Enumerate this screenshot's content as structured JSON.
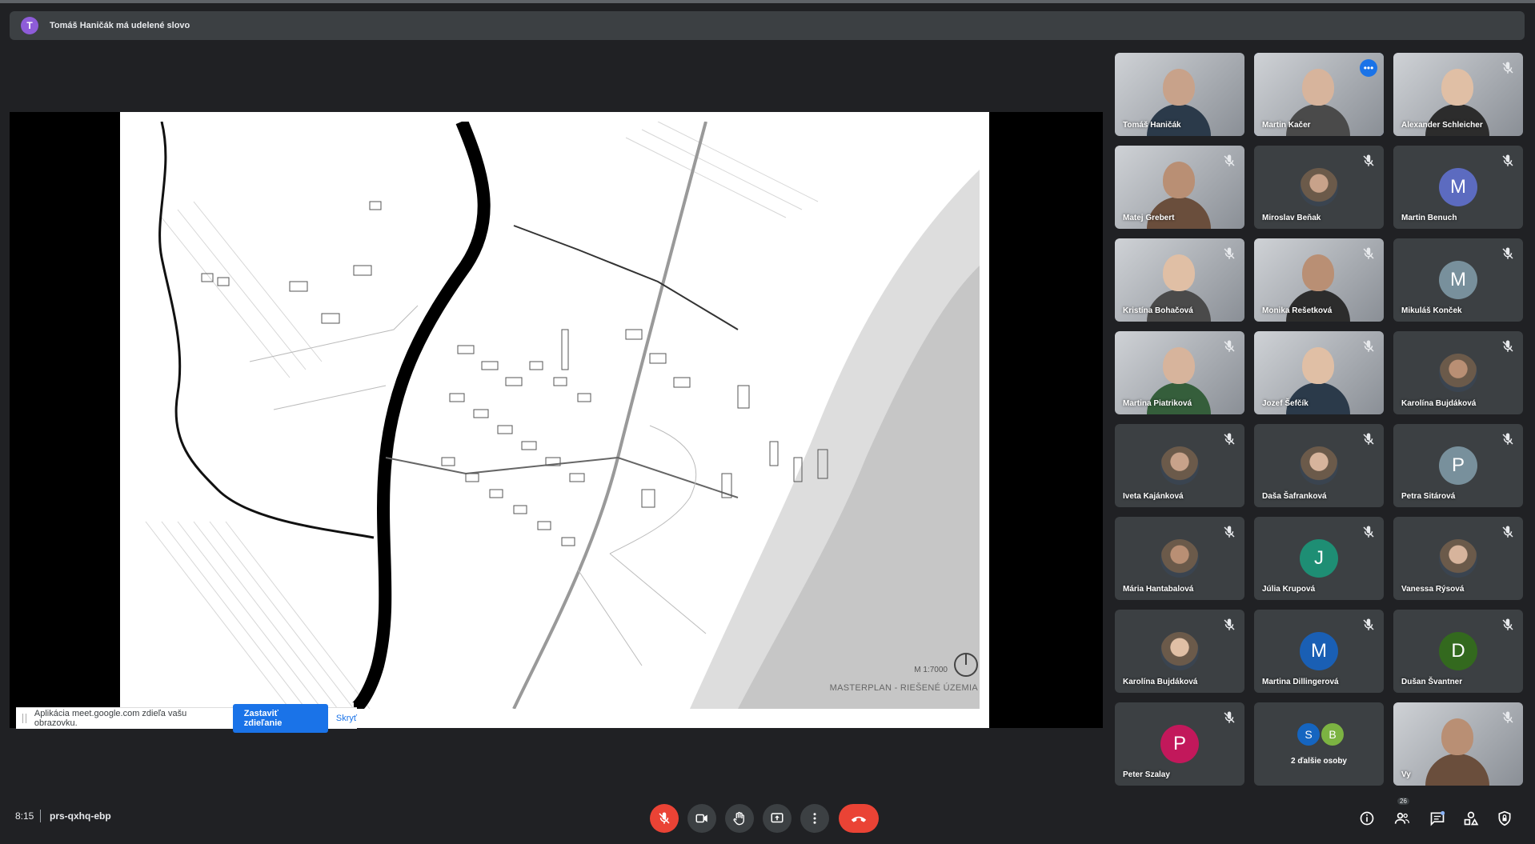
{
  "banner": {
    "avatar_letter": "T",
    "text": "Tomáš Haničák má udelené slovo"
  },
  "presentation": {
    "scale_text": "M 1:7000",
    "title_text": "MASTERPLAN - RIEŠENÉ ÚZEMIA"
  },
  "share_bar": {
    "message": "Aplikácia meet.google.com zdieľa vašu obrazovku.",
    "stop_label": "Zastaviť zdieľanie",
    "hide_label": "Skryť"
  },
  "participants": [
    {
      "name": "Tomáš Haničák",
      "kind": "video",
      "muted": false
    },
    {
      "name": "Martin Kačer",
      "kind": "video",
      "muted": false,
      "active": true
    },
    {
      "name": "Alexander Schleicher",
      "kind": "video",
      "muted": true
    },
    {
      "name": "Matej Grebert",
      "kind": "video",
      "muted": true
    },
    {
      "name": "Miroslav Beňak",
      "kind": "photo",
      "muted": true
    },
    {
      "name": "Martin Benuch",
      "kind": "letter",
      "letter": "M",
      "color": "#5c6bc0",
      "muted": true
    },
    {
      "name": "Kristína Bohačová",
      "kind": "video",
      "muted": true
    },
    {
      "name": "Monika Rešetková",
      "kind": "video",
      "muted": true
    },
    {
      "name": "Mikuláš Konček",
      "kind": "letter",
      "letter": "M",
      "color": "#78909c",
      "muted": true
    },
    {
      "name": "Martina Piatriková",
      "kind": "video",
      "muted": true
    },
    {
      "name": "Jozef Šefčík",
      "kind": "video",
      "muted": true
    },
    {
      "name": "Karolína Bujdáková",
      "kind": "photo",
      "muted": true
    },
    {
      "name": "Iveta Kajánková",
      "kind": "photo",
      "muted": true
    },
    {
      "name": "Daša Šafranková",
      "kind": "photo",
      "muted": true
    },
    {
      "name": "Petra Sitárová",
      "kind": "letter",
      "letter": "P",
      "color": "#78909c",
      "muted": true
    },
    {
      "name": "Mária Hantabalová",
      "kind": "photo",
      "muted": true
    },
    {
      "name": "Júlia Krupová",
      "kind": "letter",
      "letter": "J",
      "color": "#1e8e74",
      "muted": true
    },
    {
      "name": "Vanessa Rýsová",
      "kind": "photo",
      "muted": true
    },
    {
      "name": "Karolína Bujdáková",
      "kind": "photo",
      "muted": true
    },
    {
      "name": "Martina Dillingerová",
      "kind": "letter",
      "letter": "M",
      "color": "#1a5fb4",
      "muted": true
    },
    {
      "name": "Dušan Švantner",
      "kind": "letter",
      "letter": "D",
      "color": "#33691e",
      "muted": true
    },
    {
      "name": "Peter Szalay",
      "kind": "letter",
      "letter": "P",
      "color": "#c2185b",
      "muted": true
    },
    {
      "name": "2 ďalšie osoby",
      "kind": "more",
      "letters": [
        "S",
        "B"
      ],
      "colors": [
        "#1565c0",
        "#7cb342"
      ],
      "muted": false
    },
    {
      "name": "Vy",
      "kind": "video",
      "muted": true
    }
  ],
  "bottom_bar": {
    "time": "8:15",
    "meeting_code": "prs-qxhq-ebp",
    "participants_count": "26"
  },
  "colors": {
    "background": "#202124",
    "tile": "#3c4043",
    "accent": "#8ab4f8",
    "danger": "#ea4335"
  }
}
